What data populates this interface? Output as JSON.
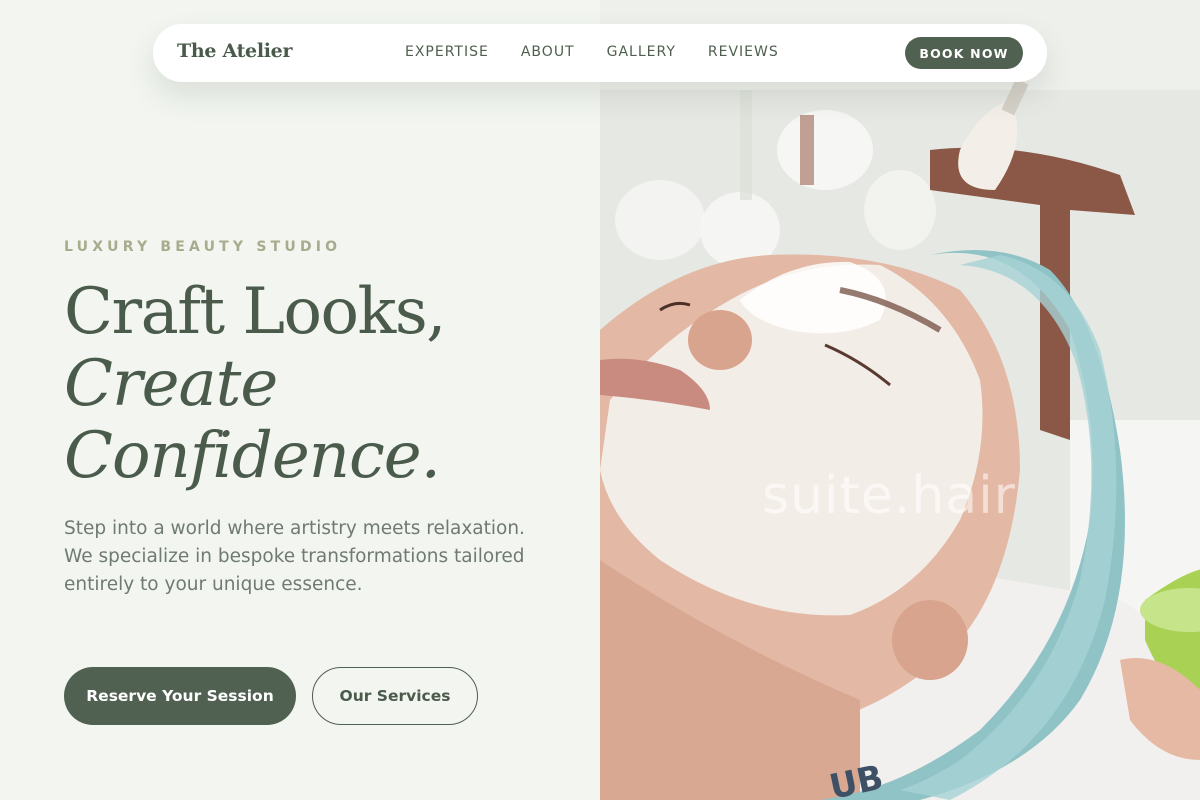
{
  "nav": {
    "brand": "The Atelier",
    "links": [
      "EXPERTISE",
      "ABOUT",
      "GALLERY",
      "REVIEWS"
    ],
    "book_label": "BOOK NOW"
  },
  "hero": {
    "eyebrow": "LUXURY BEAUTY STUDIO",
    "headline_line1": "Craft Looks,",
    "headline_line2": "Create",
    "headline_line3": "Confidence.",
    "lead": "Step into a world where artistry meets relaxation. We specialize in bespoke transformations tailored entirely to your unique essence.",
    "primary_cta": "Reserve Your Session",
    "secondary_cta": "Our Services",
    "image_watermark": "suite.hair",
    "image_description_icon": "facial-treatment-photo"
  },
  "colors": {
    "background": "#f2f5f0",
    "accent": "#516151",
    "eyebrow": "#a8ab8c",
    "body_text": "#6f7a72"
  }
}
